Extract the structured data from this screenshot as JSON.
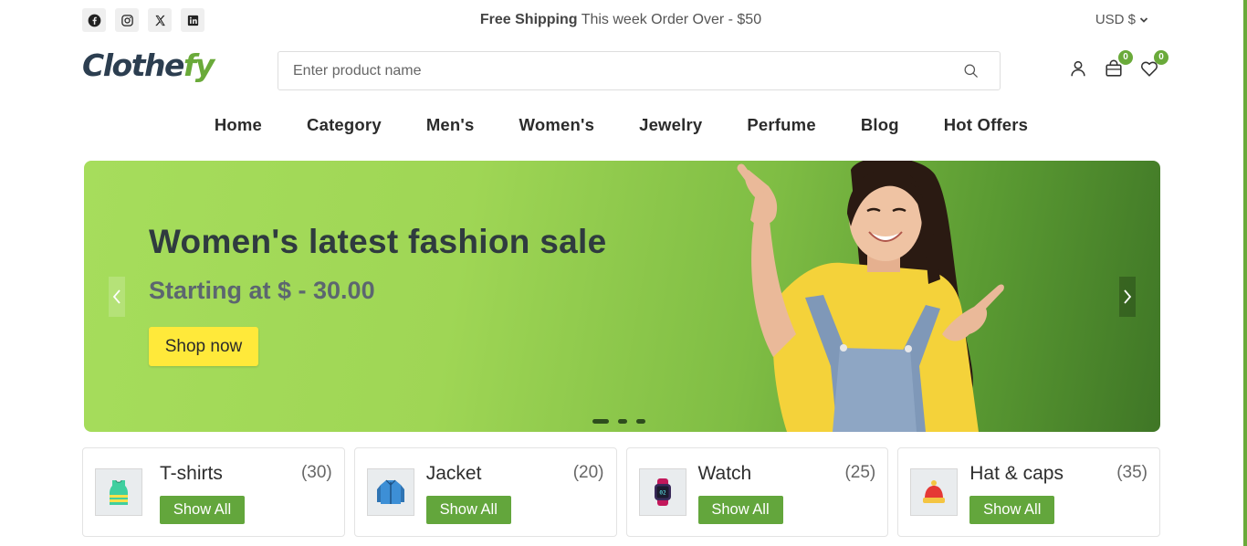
{
  "topbar": {
    "social": [
      "facebook-icon",
      "instagram-icon",
      "x-icon",
      "linkedin-icon"
    ],
    "promo_bold": "Free Shipping",
    "promo_text": " This week Order Over - $50",
    "currency": "USD $"
  },
  "header": {
    "logo_main": "Clothe",
    "logo_accent": "fy",
    "search_placeholder": "Enter product name",
    "cart_count": "0",
    "wishlist_count": "0"
  },
  "nav": [
    "Home",
    "Category",
    "Men's",
    "Women's",
    "Jewelry",
    "Perfume",
    "Blog",
    "Hot Offers"
  ],
  "hero": {
    "title": "Women's latest fashion sale",
    "subtitle": "Starting at $ - 30.00",
    "button": "Shop now",
    "slides": 3,
    "active_slide": 1
  },
  "categories": [
    {
      "name": "T-shirts",
      "count": "(30)",
      "button": "Show All",
      "icon": "tshirt-icon"
    },
    {
      "name": "Jacket",
      "count": "(20)",
      "button": "Show All",
      "icon": "jacket-icon"
    },
    {
      "name": "Watch",
      "count": "(25)",
      "button": "Show All",
      "icon": "watch-icon"
    },
    {
      "name": "Hat & caps",
      "count": "(35)",
      "button": "Show All",
      "icon": "hat-icon"
    }
  ],
  "colors": {
    "brand_green": "#6aaa3a",
    "button_yellow": "#ffe93a",
    "text_dark": "#2b2b2b"
  }
}
